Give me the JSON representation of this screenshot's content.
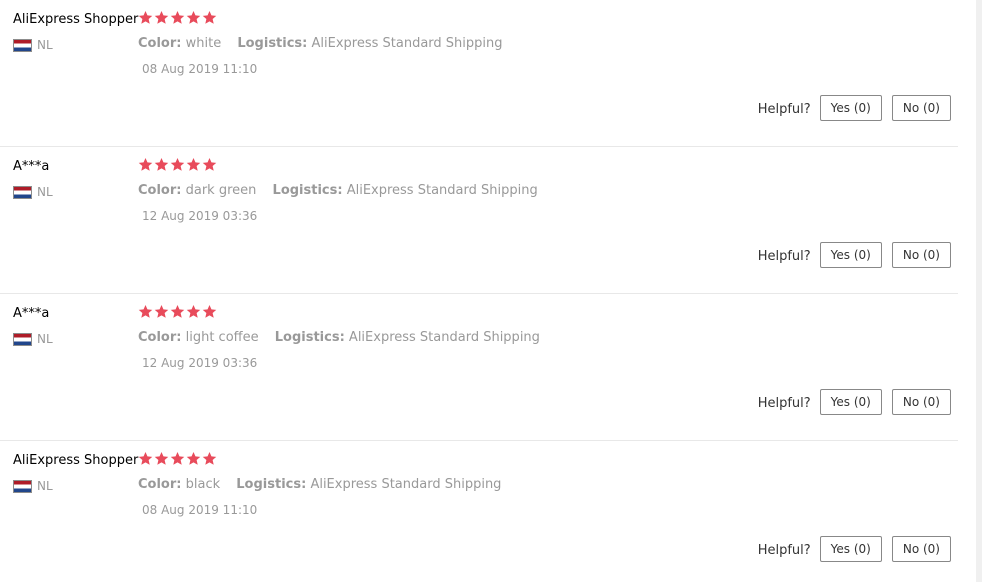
{
  "labels": {
    "color": "Color:",
    "logistics": "Logistics:",
    "helpful": "Helpful?"
  },
  "colors": {
    "star": "#e84b5b",
    "muted": "#999999"
  },
  "reviews": [
    {
      "user": "AliExpress Shopper",
      "country": "NL",
      "rating": 5,
      "color_value": "white",
      "logistics_value": "AliExpress Standard Shipping",
      "date": "08 Aug 2019 11:10",
      "yes": "Yes (0)",
      "no": "No (0)"
    },
    {
      "user": "A***a",
      "country": "NL",
      "rating": 5,
      "color_value": "dark green",
      "logistics_value": "AliExpress Standard Shipping",
      "date": "12 Aug 2019 03:36",
      "yes": "Yes (0)",
      "no": "No (0)"
    },
    {
      "user": "A***a",
      "country": "NL",
      "rating": 5,
      "color_value": "light coffee",
      "logistics_value": "AliExpress Standard Shipping",
      "date": "12 Aug 2019 03:36",
      "yes": "Yes (0)",
      "no": "No (0)"
    },
    {
      "user": "AliExpress Shopper",
      "country": "NL",
      "rating": 5,
      "color_value": "black",
      "logistics_value": "AliExpress Standard Shipping",
      "date": "08 Aug 2019 11:10",
      "yes": "Yes (0)",
      "no": "No (0)"
    }
  ]
}
